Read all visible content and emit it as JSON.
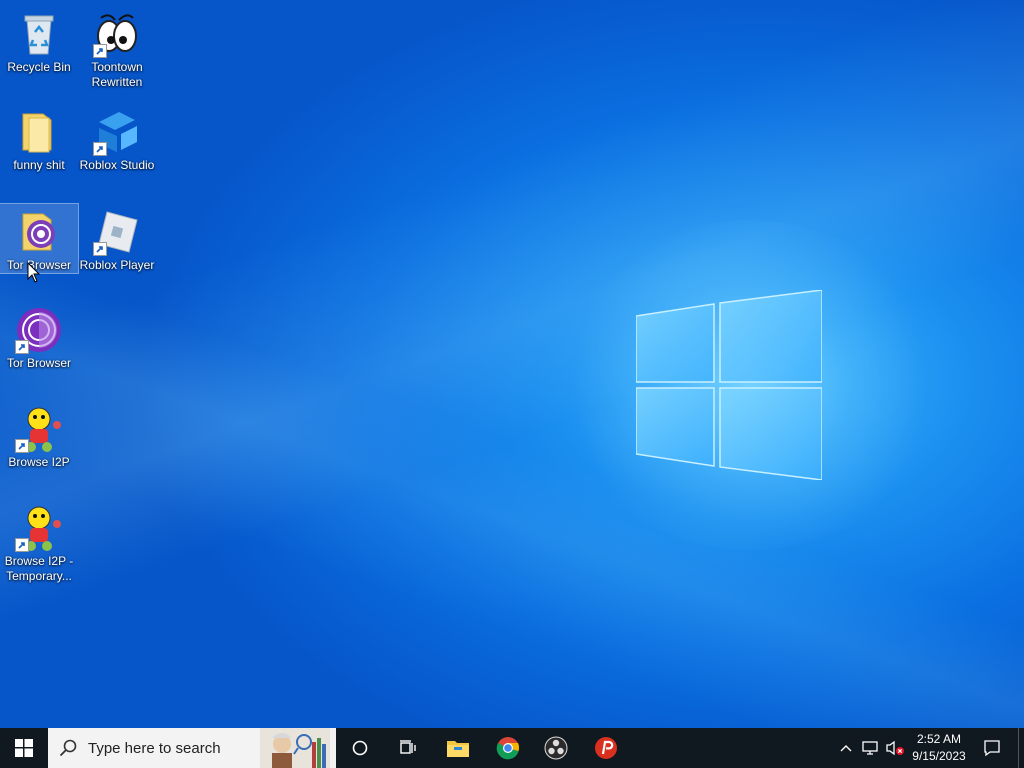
{
  "desktop": {
    "icons": [
      {
        "label": "Recycle Bin",
        "icon": "recycle-bin-icon"
      },
      {
        "label": "Toontown Rewritten",
        "icon": "toontown-icon"
      },
      {
        "label": "funny shit",
        "icon": "folder-icon"
      },
      {
        "label": "Roblox Studio",
        "icon": "roblox-studio-icon"
      },
      {
        "label": "Tor Browser",
        "icon": "tor-folder-icon"
      },
      {
        "label": "Roblox Player",
        "icon": "roblox-player-icon"
      },
      {
        "label": "Tor Browser",
        "icon": "tor-browser-icon"
      },
      {
        "label": "Browse I2P",
        "icon": "i2p-icon"
      },
      {
        "label": "Browse I2P - Temporary...",
        "icon": "i2p-icon"
      }
    ]
  },
  "taskbar": {
    "search_placeholder": "Type here to search",
    "pinned": [
      "cortana-icon",
      "task-view-icon",
      "file-explorer-icon",
      "chrome-icon",
      "obs-icon",
      "psiphon-icon"
    ],
    "clock": {
      "time": "2:52 AM",
      "date": "9/15/2023"
    }
  },
  "colors": {
    "taskbar": "#101820",
    "accent": "#0a6fe0"
  }
}
